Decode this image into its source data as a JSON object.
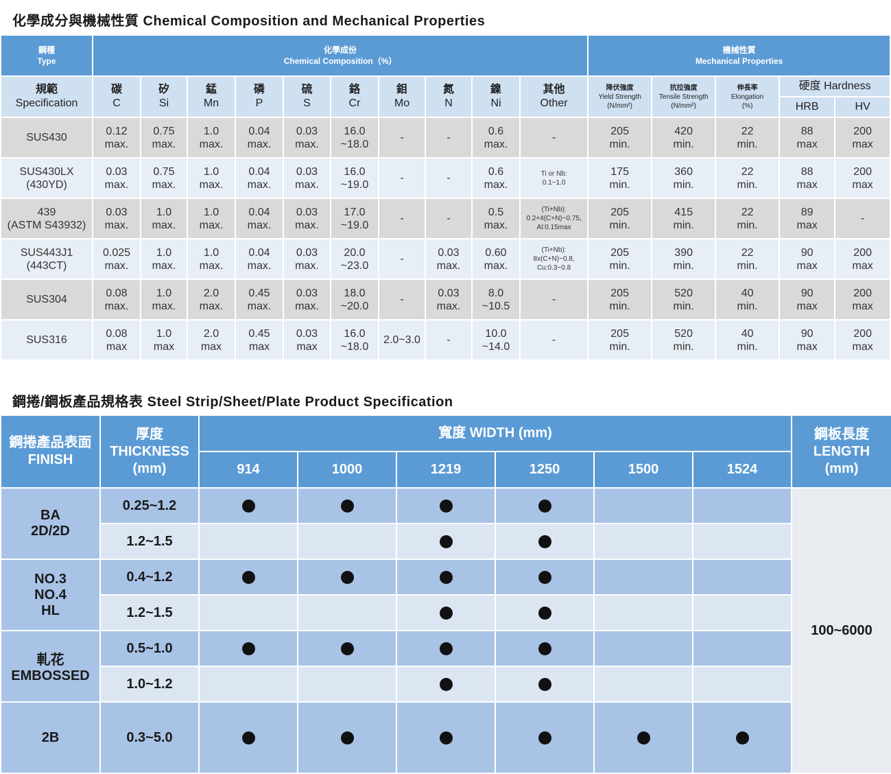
{
  "section1": {
    "title": "化學成分與機械性質 Chemical Composition and Mechanical Properties",
    "type_zh": "鋼種",
    "type_en": "Type",
    "chem_zh": "化學成份",
    "chem_en": "Chemical Composition（%）",
    "mech_zh": "機械性質",
    "mech_en": "Mechanical Properties",
    "spec_zh": "規範",
    "spec_en": "Specification",
    "elements": [
      {
        "zh": "碳",
        "en": "C"
      },
      {
        "zh": "矽",
        "en": "Si"
      },
      {
        "zh": "錳",
        "en": "Mn"
      },
      {
        "zh": "磷",
        "en": "P"
      },
      {
        "zh": "硫",
        "en": "S"
      },
      {
        "zh": "鉻",
        "en": "Cr"
      },
      {
        "zh": "鉬",
        "en": "Mo"
      },
      {
        "zh": "氮",
        "en": "N"
      },
      {
        "zh": "鎳",
        "en": "Ni"
      },
      {
        "zh": "其他",
        "en": "Other"
      }
    ],
    "mech_cols": [
      {
        "zh": "降伏強度",
        "en": "Yield Strength",
        "unit": "(N/mm²)"
      },
      {
        "zh": "抗拉強度",
        "en": "Tensile Strength",
        "unit": "(N/mm²)"
      },
      {
        "zh": "伸長率",
        "en": "Elongation",
        "unit": "(%)"
      }
    ],
    "hardness": "硬度 Hardness",
    "hrb": "HRB",
    "hv": "HV",
    "rows": [
      {
        "spec": [
          "SUS430"
        ],
        "c": [
          "0.12",
          "max."
        ],
        "si": [
          "0.75",
          "max."
        ],
        "mn": [
          "1.0",
          "max."
        ],
        "p": [
          "0.04",
          "max."
        ],
        "s": [
          "0.03",
          "max."
        ],
        "cr": [
          "16.0",
          "~18.0"
        ],
        "mo": [
          "-"
        ],
        "n": [
          "-"
        ],
        "ni": [
          "0.6",
          "max."
        ],
        "other": [
          "-"
        ],
        "ys": [
          "205",
          "min."
        ],
        "ts": [
          "420",
          "min."
        ],
        "el": [
          "22",
          "min."
        ],
        "hrb": [
          "88",
          "max"
        ],
        "hv": [
          "200",
          "max"
        ]
      },
      {
        "spec": [
          "SUS430LX",
          "(430YD)"
        ],
        "c": [
          "0.03",
          "max."
        ],
        "si": [
          "0.75",
          "max."
        ],
        "mn": [
          "1.0",
          "max."
        ],
        "p": [
          "0.04",
          "max."
        ],
        "s": [
          "0.03",
          "max."
        ],
        "cr": [
          "16.0",
          "~19.0"
        ],
        "mo": [
          "-"
        ],
        "n": [
          "-"
        ],
        "ni": [
          "0.6",
          "max."
        ],
        "other": [
          "Ti or Nb:",
          "0.1~1.0"
        ],
        "ys": [
          "175",
          "min."
        ],
        "ts": [
          "360",
          "min."
        ],
        "el": [
          "22",
          "min."
        ],
        "hrb": [
          "88",
          "max"
        ],
        "hv": [
          "200",
          "max"
        ]
      },
      {
        "spec": [
          "439",
          "(ASTM S43932)"
        ],
        "c": [
          "0.03",
          "max."
        ],
        "si": [
          "1.0",
          "max."
        ],
        "mn": [
          "1.0",
          "max."
        ],
        "p": [
          "0.04",
          "max."
        ],
        "s": [
          "0.03",
          "max."
        ],
        "cr": [
          "17.0",
          "~19.0"
        ],
        "mo": [
          "-"
        ],
        "n": [
          "-"
        ],
        "ni": [
          "0.5",
          "max."
        ],
        "other": [
          "(Ti+Nb):",
          "0.2+4(C+N)~0.75,",
          "Al:0.15max"
        ],
        "ys": [
          "205",
          "min."
        ],
        "ts": [
          "415",
          "min."
        ],
        "el": [
          "22",
          "min."
        ],
        "hrb": [
          "89",
          "max"
        ],
        "hv": [
          "-"
        ]
      },
      {
        "spec": [
          "SUS443J1",
          "(443CT)"
        ],
        "c": [
          "0.025",
          "max."
        ],
        "si": [
          "1.0",
          "max."
        ],
        "mn": [
          "1.0",
          "max."
        ],
        "p": [
          "0.04",
          "max."
        ],
        "s": [
          "0.03",
          "max."
        ],
        "cr": [
          "20.0",
          "~23.0"
        ],
        "mo": [
          "-"
        ],
        "n": [
          "0.03",
          "max."
        ],
        "ni": [
          "0.60",
          "max."
        ],
        "other": [
          "(Ti+Nb):",
          "8x(C+N)~0.8,",
          "Cu:0.3~0.8"
        ],
        "ys": [
          "205",
          "min."
        ],
        "ts": [
          "390",
          "min."
        ],
        "el": [
          "22",
          "min."
        ],
        "hrb": [
          "90",
          "max"
        ],
        "hv": [
          "200",
          "max"
        ]
      },
      {
        "spec": [
          "SUS304"
        ],
        "c": [
          "0.08",
          "max."
        ],
        "si": [
          "1.0",
          "max."
        ],
        "mn": [
          "2.0",
          "max."
        ],
        "p": [
          "0.45",
          "max."
        ],
        "s": [
          "0.03",
          "max."
        ],
        "cr": [
          "18.0",
          "~20.0"
        ],
        "mo": [
          "-"
        ],
        "n": [
          "0.03",
          "max."
        ],
        "ni": [
          "8.0",
          "~10.5"
        ],
        "other": [
          "-"
        ],
        "ys": [
          "205",
          "min."
        ],
        "ts": [
          "520",
          "min."
        ],
        "el": [
          "40",
          "min."
        ],
        "hrb": [
          "90",
          "max"
        ],
        "hv": [
          "200",
          "max"
        ]
      },
      {
        "spec": [
          "SUS316"
        ],
        "c": [
          "0.08",
          "max"
        ],
        "si": [
          "1.0",
          "max"
        ],
        "mn": [
          "2.0",
          "max"
        ],
        "p": [
          "0.45",
          "max"
        ],
        "s": [
          "0.03",
          "max"
        ],
        "cr": [
          "16.0",
          "~18.0"
        ],
        "mo": [
          "2.0~3.0"
        ],
        "n": [
          "-"
        ],
        "ni": [
          "10.0",
          "~14.0"
        ],
        "other": [
          "-"
        ],
        "ys": [
          "205",
          "min."
        ],
        "ts": [
          "520",
          "min."
        ],
        "el": [
          "40",
          "min."
        ],
        "hrb": [
          "90",
          "max"
        ],
        "hv": [
          "200",
          "max"
        ]
      }
    ]
  },
  "section2": {
    "title": "鋼捲/鋼板產品規格表 Steel Strip/Sheet/Plate Product Specification",
    "finish_zh": "鋼捲產品表面",
    "finish_en": "FINISH",
    "thick_zh": "厚度",
    "thick_en": "THICKNESS",
    "thick_unit": "(mm)",
    "width": "寬度 WIDTH (mm)",
    "widths": [
      "914",
      "1000",
      "1219",
      "1250",
      "1500",
      "1524"
    ],
    "length_zh": "鋼板長度",
    "length_en": "LENGTH",
    "length_unit": "(mm)",
    "length_value": "100~6000",
    "groups": [
      {
        "finish": [
          "BA",
          "2D/2D"
        ],
        "rows": [
          {
            "thickness": "0.25~1.2",
            "avail": [
              true,
              true,
              true,
              true,
              false,
              false
            ]
          },
          {
            "thickness": "1.2~1.5",
            "avail": [
              false,
              false,
              true,
              true,
              false,
              false
            ]
          }
        ]
      },
      {
        "finish": [
          "NO.3",
          "NO.4",
          "HL"
        ],
        "rows": [
          {
            "thickness": "0.4~1.2",
            "avail": [
              true,
              true,
              true,
              true,
              false,
              false
            ]
          },
          {
            "thickness": "1.2~1.5",
            "avail": [
              false,
              false,
              true,
              true,
              false,
              false
            ]
          }
        ]
      },
      {
        "finish": [
          "軋花",
          "EMBOSSED"
        ],
        "rows": [
          {
            "thickness": "0.5~1.0",
            "avail": [
              true,
              true,
              true,
              true,
              false,
              false
            ]
          },
          {
            "thickness": "1.0~1.2",
            "avail": [
              false,
              false,
              true,
              true,
              false,
              false
            ]
          }
        ]
      },
      {
        "finish": [
          "2B"
        ],
        "rows": [
          {
            "thickness": "0.3~5.0",
            "avail": [
              true,
              true,
              true,
              true,
              true,
              true
            ]
          }
        ]
      }
    ]
  }
}
